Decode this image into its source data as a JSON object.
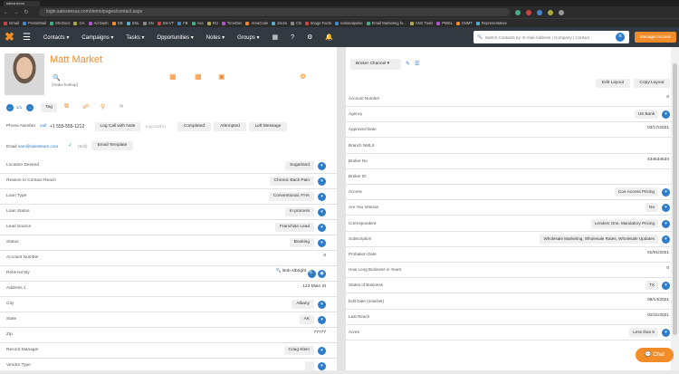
{
  "browser": {
    "tab_title": "salesnexus",
    "url": "login.salesnexus.com/demo/pages/contact.aspx",
    "bookmarks": [
      "Gmail",
      "ProtonMail",
      "SN Docs",
      "GA",
      "Ad Dash",
      "GB",
      "SNL",
      "SN",
      "SN-VT",
      "FB",
      "Axe",
      "RU",
      "TimeDoc",
      "AreaCode",
      "Zoom",
      "CB",
      "Image Facts",
      "nationalpulse",
      "Email Marketing fo...",
      "ANX Tools",
      "PMDL",
      "SNMT",
      "Representative"
    ]
  },
  "nav": {
    "items": [
      "Contacts",
      "Campaigns",
      "Tasks",
      "Opportunities",
      "Notes",
      "Groups"
    ],
    "search_placeholder": "Switch Contacts by: E-mail Address | Company | Contact",
    "manager_button": "Manager Access"
  },
  "contact": {
    "name": "Matt Market",
    "lookup_label": "(make lookup)",
    "tag_label": "Tag",
    "phone_label": "Phone Number",
    "phone_call": "call",
    "phone_value": "+1 555-555-1212",
    "log_call_note": "Log Call with Note",
    "log_call_in": "Log Call In",
    "completed": "Completed",
    "attempted": "Attempted",
    "left_message": "Left Message",
    "email_label": "Email",
    "email_value": "sam@salesteam.com",
    "email_extra": "(Edit)",
    "email_template": "Email Template"
  },
  "left_fields": [
    {
      "label": "Location Desired",
      "value": "Sugarland",
      "type": "pill"
    },
    {
      "label": "Reason to Contact Reach",
      "value": "Chronic Back Pain",
      "type": "pill"
    },
    {
      "label": "Loan Type",
      "value": "Conventional, FHA",
      "type": "pill"
    },
    {
      "label": "Loan Status",
      "value": "In process",
      "type": "pill"
    },
    {
      "label": "Lead Source",
      "value": "Franchise Lead",
      "type": "pill"
    },
    {
      "label": "Status",
      "value": "Booking",
      "type": "pill"
    },
    {
      "label": "Account Number",
      "value": "0",
      "type": "text"
    },
    {
      "label": "Referred By",
      "value": "Bob Albright",
      "type": "search"
    },
    {
      "label": "Address 1",
      "value": "123 Main St",
      "type": "text"
    },
    {
      "label": "City",
      "value": "Albany",
      "type": "pill"
    },
    {
      "label": "State",
      "value": "AK",
      "type": "pill"
    },
    {
      "label": "Zip",
      "value": "77777",
      "type": "text"
    },
    {
      "label": "Record Manager",
      "value": "Craig Klein",
      "type": "pill"
    },
    {
      "label": "Vendor Type",
      "value": "",
      "type": "pill"
    }
  ],
  "right_header": {
    "view_select": "Broker Channel",
    "edit_layout": "Edit Layout",
    "copy_layout": "Copy Layout"
  },
  "right_fields": [
    {
      "label": "Account Number",
      "value": "0",
      "type": "text"
    },
    {
      "label": "Agency",
      "value": "US Bank",
      "type": "pill"
    },
    {
      "label": "Approved Date",
      "value": "03/17/2021",
      "type": "text"
    },
    {
      "label": "Branch NMLS",
      "value": "",
      "type": "text"
    },
    {
      "label": "Broker No.",
      "value": "434534534",
      "type": "text"
    },
    {
      "label": "Broker ID",
      "value": "",
      "type": "text"
    },
    {
      "label": "Access",
      "value": "Coo-Access Pricing",
      "type": "pill"
    },
    {
      "label": "Are You Veteran",
      "value": "No",
      "type": "pill"
    },
    {
      "label": "Correspondent",
      "value": "Lenders One, Mandatory Pricing",
      "type": "pill"
    },
    {
      "label": "Subscription",
      "value": "Wholesale Marketing, Wholesale Rates, Wholesale Updates",
      "type": "pill"
    },
    {
      "label": "Probation Date",
      "value": "01/01/2021",
      "type": "text"
    },
    {
      "label": "How Long Business in Years",
      "value": "0",
      "type": "text"
    },
    {
      "label": "States of Business",
      "value": "TX",
      "type": "pill"
    },
    {
      "label": "Edit Date (now/set)",
      "value": "09/14/2021",
      "type": "text"
    },
    {
      "label": "Last Reach",
      "value": "02/11/2021",
      "type": "text"
    },
    {
      "label": "Acres",
      "value": "Less than 5",
      "type": "pill"
    }
  ],
  "chat_label": "Chat",
  "colors": {
    "accent": "#f28c28",
    "nav_bg": "#333940",
    "chevron": "#2d7cc8"
  }
}
